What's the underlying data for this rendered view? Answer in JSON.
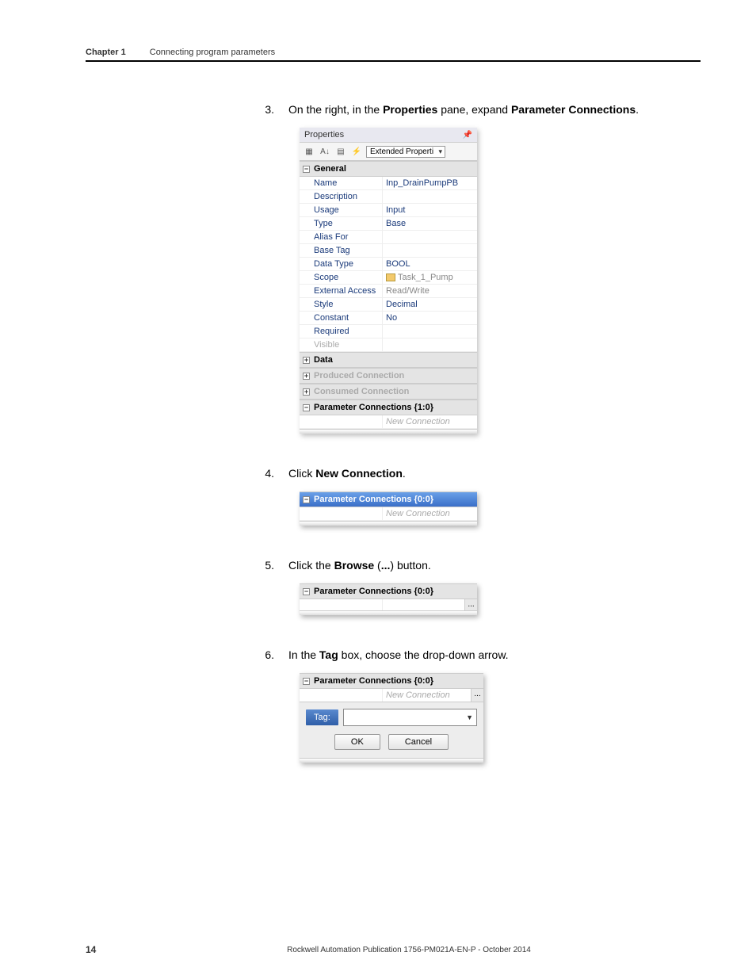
{
  "header": {
    "chapter": "Chapter 1",
    "section": "Connecting program parameters"
  },
  "steps": {
    "s3": {
      "num": "3.",
      "pre": "On the right, in the ",
      "b1": "Properties",
      "mid": " pane, expand ",
      "b2": "Parameter Connections",
      "post": "."
    },
    "s4": {
      "num": "4.",
      "pre": "Click ",
      "b1": "New Connection",
      "post": "."
    },
    "s5": {
      "num": "5.",
      "pre": "Click the ",
      "b1": "Browse",
      "mid": " (",
      "b2": "...",
      "post": ") button."
    },
    "s6": {
      "num": "6.",
      "pre": "In the ",
      "b1": "Tag",
      "post": " box, choose the drop-down arrow."
    }
  },
  "props": {
    "title": "Properties",
    "dropdown": "Extended Properti",
    "group_general": "General",
    "rows": {
      "name_k": "Name",
      "name_v": "Inp_DrainPumpPB",
      "desc_k": "Description",
      "desc_v": "",
      "usage_k": "Usage",
      "usage_v": "Input",
      "type_k": "Type",
      "type_v": "Base",
      "alias_k": "Alias For",
      "alias_v": "",
      "basetag_k": "Base Tag",
      "basetag_v": "",
      "dtype_k": "Data Type",
      "dtype_v": "BOOL",
      "scope_k": "Scope",
      "scope_v": "Task_1_Pump",
      "ext_k": "External Access",
      "ext_v": "Read/Write",
      "style_k": "Style",
      "style_v": "Decimal",
      "const_k": "Constant",
      "const_v": "No",
      "req_k": "Required",
      "req_v": "",
      "vis_k": "Visible",
      "vis_v": ""
    },
    "group_data": "Data",
    "group_produced": "Produced Connection",
    "group_consumed": "Consumed Connection",
    "group_param": "Parameter Connections {1:0}",
    "new_conn": "New Connection"
  },
  "mini4": {
    "header": "Parameter Connections {0:0}",
    "value": "New Connection"
  },
  "mini5": {
    "header": "Parameter Connections {0:0}",
    "dots": "..."
  },
  "mini6": {
    "header": "Parameter Connections {0:0}",
    "value": "New Connection",
    "dots": "...",
    "tag_label": "Tag:",
    "ok": "OK",
    "cancel": "Cancel"
  },
  "footer": {
    "pagenum": "14",
    "publication": "Rockwell Automation Publication 1756-PM021A-EN-P - October 2014"
  }
}
